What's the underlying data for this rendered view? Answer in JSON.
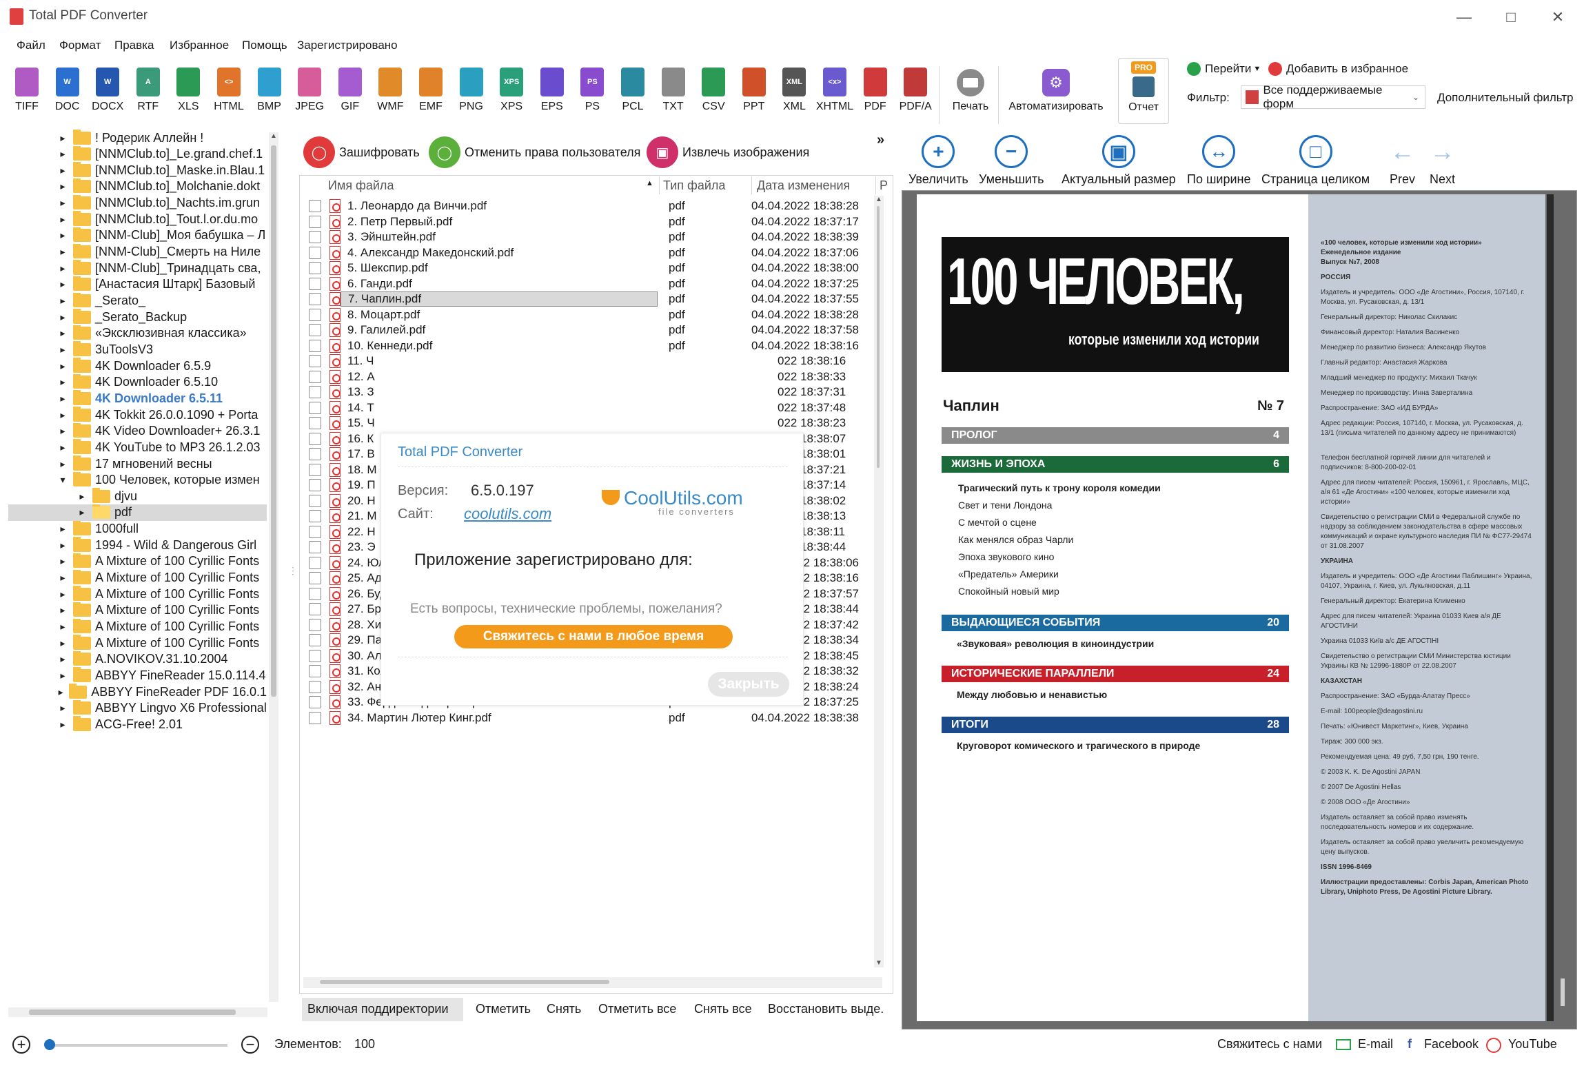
{
  "window": {
    "title": "Total PDF Converter"
  },
  "menu": [
    "Файл",
    "Формат",
    "Правка",
    "Избранное",
    "Помощь",
    "Зарегистрировано"
  ],
  "formats": [
    {
      "label": "TIFF",
      "color": "#b05bc4",
      "glyph": ""
    },
    {
      "label": "DOC",
      "color": "#2b6fd0",
      "glyph": "W"
    },
    {
      "label": "DOCX",
      "color": "#2557b0",
      "glyph": "W"
    },
    {
      "label": "RTF",
      "color": "#3a9a7a",
      "glyph": "A"
    },
    {
      "label": "XLS",
      "color": "#2a9a55",
      "glyph": ""
    },
    {
      "label": "HTML",
      "color": "#e0742a",
      "glyph": "<>"
    },
    {
      "label": "BMP",
      "color": "#2f9fcf",
      "glyph": ""
    },
    {
      "label": "JPEG",
      "color": "#d65c9a",
      "glyph": ""
    },
    {
      "label": "GIF",
      "color": "#a45cd0",
      "glyph": ""
    },
    {
      "label": "WMF",
      "color": "#e08a2a",
      "glyph": ""
    },
    {
      "label": "EMF",
      "color": "#e0822a",
      "glyph": ""
    },
    {
      "label": "PNG",
      "color": "#2a9fbf",
      "glyph": ""
    },
    {
      "label": "XPS",
      "color": "#2aa07a",
      "glyph": "XPS"
    },
    {
      "label": "EPS",
      "color": "#6a4ccf",
      "glyph": ""
    },
    {
      "label": "PS",
      "color": "#8a4ccf",
      "glyph": "PS"
    },
    {
      "label": "PCL",
      "color": "#2a8a9f",
      "glyph": ""
    },
    {
      "label": "TXT",
      "color": "#8a8a8a",
      "glyph": ""
    },
    {
      "label": "CSV",
      "color": "#2a9a55",
      "glyph": ""
    },
    {
      "label": "PPT",
      "color": "#d0502a",
      "glyph": ""
    },
    {
      "label": "XML",
      "color": "#555555",
      "glyph": "XML"
    },
    {
      "label": "XHTML",
      "color": "#6a5ad0",
      "glyph": "<x>"
    },
    {
      "label": "PDF",
      "color": "#d03a3a",
      "glyph": ""
    },
    {
      "label": "PDF/A",
      "color": "#c03a3a",
      "glyph": ""
    }
  ],
  "toolbar": {
    "print": "Печать",
    "automate": "Автоматизировать",
    "report": "Отчет",
    "pro": "PRO",
    "goto": "Перейти",
    "add_fav": "Добавить в избранное",
    "filter_label": "Фильтр:",
    "filter_value": "Все поддерживаемые форм",
    "extra_filter": "Дополнительный фильтр"
  },
  "tree": [
    {
      "label": "! Родерик Аллейн !",
      "level": 0
    },
    {
      "label": "[NNMClub.to]_Le.grand.chef.1",
      "level": 0
    },
    {
      "label": "[NNMClub.to]_Maske.in.Blau.1",
      "level": 0
    },
    {
      "label": "[NNMClub.to]_Molchanie.dokt",
      "level": 0
    },
    {
      "label": "[NNMClub.to]_Nachts.im.grun",
      "level": 0
    },
    {
      "label": "[NNMClub.to]_Tout.l.or.du.mo",
      "level": 0
    },
    {
      "label": "[NNM-Club]_Моя бабушка – Л",
      "level": 0
    },
    {
      "label": "[NNM-Club]_Смерть на Ниле",
      "level": 0
    },
    {
      "label": "[NNM-Club]_Тринадцать сва,",
      "level": 0
    },
    {
      "label": "[Анастасия Штарк] Базовый",
      "level": 0
    },
    {
      "label": "_Serato_",
      "level": 0
    },
    {
      "label": "_Serato_Backup",
      "level": 0
    },
    {
      "label": "«Эксклюзивная классика»",
      "level": 0
    },
    {
      "label": "3uToolsV3",
      "level": 0
    },
    {
      "label": "4K Downloader 6.5.9",
      "level": 0
    },
    {
      "label": "4K Downloader 6.5.10",
      "level": 0
    },
    {
      "label": "4K Downloader 6.5.11",
      "level": 0,
      "highlight": true
    },
    {
      "label": "4K Tokkit 26.0.0.1090 + Porta",
      "level": 0
    },
    {
      "label": "4K Video Downloader+ 26.3.1",
      "level": 0
    },
    {
      "label": "4K YouTube to MP3 26.1.2.03",
      "level": 0
    },
    {
      "label": "17 мгновений весны",
      "level": 0
    },
    {
      "label": "100 Человек, которые измен",
      "level": 0,
      "open": true
    },
    {
      "label": "djvu",
      "level": 1
    },
    {
      "label": "pdf",
      "level": 1,
      "selected": true
    },
    {
      "label": "1000full",
      "level": 0
    },
    {
      "label": "1994 - Wild & Dangerous Girl",
      "level": 0
    },
    {
      "label": "A Mixture of 100 Cyrillic Fonts",
      "level": 0
    },
    {
      "label": "A Mixture of 100 Cyrillic Fonts",
      "level": 0
    },
    {
      "label": "A Mixture of 100 Cyrillic Fonts",
      "level": 0
    },
    {
      "label": "A Mixture of 100 Cyrillic Fonts",
      "level": 0
    },
    {
      "label": "A Mixture of 100 Cyrillic Fonts",
      "level": 0
    },
    {
      "label": "A Mixture of 100 Cyrillic Fonts",
      "level": 0
    },
    {
      "label": "A.NOVIKOV.31.10.2004",
      "level": 0
    },
    {
      "label": "ABBYY FineReader 15.0.114.4",
      "level": 0
    },
    {
      "label": "ABBYY FineReader PDF 16.0.1",
      "level": 0
    },
    {
      "label": "ABBYY Lingvo X6 Professional",
      "level": 0
    },
    {
      "label": "ACG-Free! 2.01",
      "level": 0
    }
  ],
  "actions": {
    "encrypt": "Зашифровать",
    "revoke": "Отменить права пользователя",
    "extract": "Извлечь изображения"
  },
  "columns": {
    "name": "Имя файла",
    "type": "Тип файла",
    "date": "Дата изменения",
    "size": "Р"
  },
  "files": [
    {
      "name": "1. Леонардо да Винчи.pdf",
      "type": "pdf",
      "date": "04.04.2022 18:38:28"
    },
    {
      "name": "2. Петр Первый.pdf",
      "type": "pdf",
      "date": "04.04.2022 18:37:17"
    },
    {
      "name": "3. Эйнштейн.pdf",
      "type": "pdf",
      "date": "04.04.2022 18:38:39"
    },
    {
      "name": "4. Александр Македонский.pdf",
      "type": "pdf",
      "date": "04.04.2022 18:37:06"
    },
    {
      "name": "5. Шекспир.pdf",
      "type": "pdf",
      "date": "04.04.2022 18:38:00"
    },
    {
      "name": "6. Ганди.pdf",
      "type": "pdf",
      "date": "04.04.2022 18:37:25"
    },
    {
      "name": "7. Чаплин.pdf",
      "type": "pdf",
      "date": "04.04.2022 18:37:55",
      "selected": true
    },
    {
      "name": "8. Моцарт.pdf",
      "type": "pdf",
      "date": "04.04.2022 18:38:28"
    },
    {
      "name": "9. Галилей.pdf",
      "type": "pdf",
      "date": "04.04.2022 18:37:58"
    },
    {
      "name": "10. Кеннеди.pdf",
      "type": "pdf",
      "date": "04.04.2022 18:38:16"
    },
    {
      "name": "11. Ч",
      "type": "",
      "date": "022 18:38:16"
    },
    {
      "name": "12. А",
      "type": "",
      "date": "022 18:38:33"
    },
    {
      "name": "13. З",
      "type": "",
      "date": "022 18:37:31"
    },
    {
      "name": "14. Т",
      "type": "",
      "date": "022 18:37:48"
    },
    {
      "name": "15. Ч",
      "type": "",
      "date": "022 18:38:23"
    },
    {
      "name": "16. К",
      "type": "",
      "date": "022 18:38:07"
    },
    {
      "name": "17. В",
      "type": "",
      "date": "022 18:38:01"
    },
    {
      "name": "18. М",
      "type": "",
      "date": "022 18:37:21"
    },
    {
      "name": "19. П",
      "type": "",
      "date": "022 18:37:14"
    },
    {
      "name": "20. Н",
      "type": "",
      "date": "022 18:38:02"
    },
    {
      "name": "21. М",
      "type": "",
      "date": "022 18:38:13"
    },
    {
      "name": "22. Н",
      "type": "",
      "date": "022 18:38:11"
    },
    {
      "name": "23. Э",
      "type": "",
      "date": "022 18:38:44"
    },
    {
      "name": "24. Юлий Цезарь.pdf",
      "type": "pdf",
      "date": "04.04.2022 18:38:06"
    },
    {
      "name": "25. Адольф Гитлер.pdf",
      "type": "pdf",
      "date": "04.04.2022 18:38:16"
    },
    {
      "name": "26. Будда.pdf",
      "type": "pdf",
      "date": "04.04.2022 18:37:57"
    },
    {
      "name": "27. Братья Гримм.pdf",
      "type": "pdf",
      "date": "04.04.2022 18:38:44"
    },
    {
      "name": "28. Хичкок.pdf",
      "type": "pdf",
      "date": "04.04.2022 18:37:42"
    },
    {
      "name": "29. Пабло Пикассо.pdf",
      "type": "pdf",
      "date": "04.04.2022 18:38:34"
    },
    {
      "name": "30. Аль Капоне.pdf",
      "type": "pdf",
      "date": "04.04.2022 18:38:45"
    },
    {
      "name": "31. Колумб.pdf",
      "type": "pdf",
      "date": "04.04.2022 18:38:32"
    },
    {
      "name": "32. Антони Гауди.pdf",
      "type": "pdf",
      "date": "04.04.2022 18:38:24"
    },
    {
      "name": "33. Фердинанд Порше.pdf",
      "type": "pdf",
      "date": "04.04.2022 18:37:25"
    },
    {
      "name": "34. Мартин Лютер Кинг.pdf",
      "type": "pdf",
      "date": "04.04.2022 18:38:38"
    }
  ],
  "dialog": {
    "title": "Total PDF Converter",
    "version_label": "Версия:",
    "version": "6.5.0.197",
    "site_label": "Сайт:",
    "site": "coolutils.com",
    "logo_main": "CoolUtils.com",
    "logo_sub": "file converters",
    "registered": "Приложение зарегистрировано для:",
    "question": "Есть вопросы, технические проблемы, пожелания?",
    "contact_btn": "Свяжитесь с нами в любое время",
    "close_btn": "Закрыть"
  },
  "bottom": {
    "subdirs": "Включая поддиректории",
    "check": "Отметить",
    "uncheck": "Снять",
    "check_all": "Отметить все",
    "uncheck_all": "Снять все",
    "restore": "Восстановить выде."
  },
  "viewer": {
    "zoom_in": "Увеличить",
    "zoom_out": "Уменьшить",
    "actual": "Актуальный размер",
    "fit_width": "По ширине",
    "full_page": "Страница целиком",
    "prev": "Prev",
    "next": "Next"
  },
  "page": {
    "title_big": "100 ЧЕЛОВЕК,",
    "title_sub": "которые изменили ход истории",
    "person": "Чаплин",
    "issue": "№ 7",
    "sec1": "ПРОЛОГ",
    "sec1_n": "4",
    "sec2": "ЖИЗНЬ И ЭПОХА",
    "sec2_n": "6",
    "items2": [
      "Трагический путь к трону короля комедии",
      "Свет и тени Лондона",
      "С мечтой о сцене",
      "Как менялся образ Чарли",
      "Эпоха звукового кино",
      "«Предатель» Америки",
      "Спокойный новый мир"
    ],
    "sec3": "ВЫДАЮЩИЕСЯ СОБЫТИЯ",
    "sec3_n": "20",
    "item3": "«Звуковая» революция в киноиндустрии",
    "sec4": "ИСТОРИЧЕСКИЕ ПАРАЛЛЕЛИ",
    "sec4_n": "24",
    "item4": "Между любовью и ненавистью",
    "sec5": "ИТОГИ",
    "sec5_n": "28",
    "item5": "Круговорот комического и трагического в природе",
    "side": [
      "«100 человек, которые изменили ход истории»",
      "Еженедельное издание",
      "Выпуск №7, 2008",
      "РОССИЯ",
      "Издатель и учредитель: ООО «Де Агостини», Россия, 107140, г. Москва, ул. Русаковская, д. 13/1",
      "Генеральный директор: Николас Скилакис",
      "Финансовый директор: Наталия Васиненко",
      "Менеджер по развитию бизнеса: Александр Якутов",
      "Главный редактор: Анастасия Жаркова",
      "Младший менеджер по продукту: Михаил Ткачук",
      "Менеджер по производству: Инна Заверталина",
      "Распространение: ЗАО «ИД БУРДА»",
      "Адрес редакции: Россия, 107140, г. Москва, ул. Русаковская, д. 13/1 (письма читателей по данному адресу не принимаются)",
      "Телефон бесплатной горячей линии для читателей и подписчиков: 8-800-200-02-01",
      "Адрес для писем читателей: Россия, 150961, г. Ярославль, МЦС, а/я 61 «Де Агостини» «100 человек, которые изменили ход истории»",
      "Свидетельство о регистрации СМИ в Федеральной службе по надзору за соблюдением законодательства в сфере массовых коммуникаций и охране культурного наследия ПИ № ФС77-29474 от 31.08.2007",
      "УКРАИНА",
      "Издатель и учредитель: ООО «Де Агостини Паблишинг» Украина, 04107, Украина, г. Киев, ул. Лукьяновская, д.11",
      "Генеральный директор: Екатерина Клименко",
      "Адрес для писем читателей: Украина 01033 Киев а/я ДЕ АГОСТИНИ",
      "Украина 01033 Київ а/с ДЕ АГОСТІНІ",
      "Свидетельство о регистрации СМИ Министерства юстиции Украины КВ № 12996-1880Р от 22.08.2007",
      "КАЗАХСТАН",
      "Распространение: ЗАО «Бурда-Алатау Пресс»",
      "E-mail: 100people@deagostini.ru",
      "Печать: «Юнивест Маркетинг», Киев, Украина",
      "Тираж: 300 000 экз.",
      "Рекомендуемая цена: 49 руб, 7,50 грн, 190 тенге.",
      "© 2003 K. K. De Agostini JAPAN",
      "© 2007 De Agostini Hellas",
      "© 2008 ООО «Де Агостини»",
      "Издатель оставляет за собой право изменять последовательность номеров и их содержание.",
      "Издатель оставляет за собой право увеличить рекомендуемую цену выпусков.",
      "ISSN 1996-8469",
      "Иллюстрации предоставлены: Corbis Japan, American Photo Library, Uniphoto Press, De Agostini Picture Library."
    ]
  },
  "status": {
    "items_label": "Элементов:",
    "items_count": "100",
    "contact": "Свяжитесь с нами",
    "email": "E-mail",
    "facebook": "Facebook",
    "youtube": "YouTube"
  },
  "colors": {
    "accent": "#1e6fbf",
    "orange": "#f39a1a",
    "sec_grey": "#8a8a8a",
    "sec_green": "#1a6a3a",
    "sec_blue": "#1a6aa0",
    "sec_red": "#c8202a",
    "sec_navy": "#1a4a8a"
  }
}
